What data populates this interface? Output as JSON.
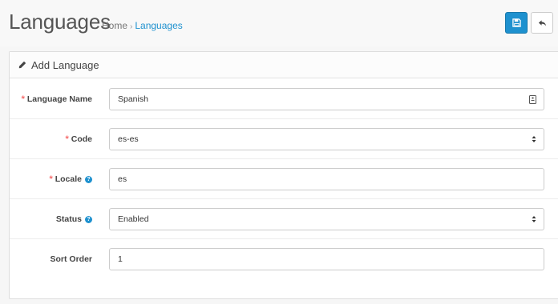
{
  "header": {
    "title": "Languages",
    "breadcrumb": [
      "Home",
      "Languages"
    ],
    "breadcrumb_separator": "›",
    "save_icon": "floppy-disk-icon",
    "back_icon": "reply-arrow-icon",
    "accent_color": "#1e91cf"
  },
  "panel": {
    "title": "Add Language",
    "title_icon": "pencil-icon"
  },
  "form": {
    "language_name": {
      "label": "Language Name",
      "required_mark": "*",
      "value": "Spanish",
      "suffix_icon": "contact-card-icon"
    },
    "code": {
      "label": "Code",
      "required_mark": "*",
      "value": "es-es",
      "type": "select"
    },
    "locale": {
      "label": "Locale",
      "required_mark": "*",
      "value": "es",
      "help_icon": "question-circle-icon",
      "help_glyph": "?"
    },
    "status": {
      "label": "Status",
      "value": "Enabled",
      "type": "select",
      "help_icon": "question-circle-icon",
      "help_glyph": "?"
    },
    "sort_order": {
      "label": "Sort Order",
      "value": "1"
    }
  }
}
